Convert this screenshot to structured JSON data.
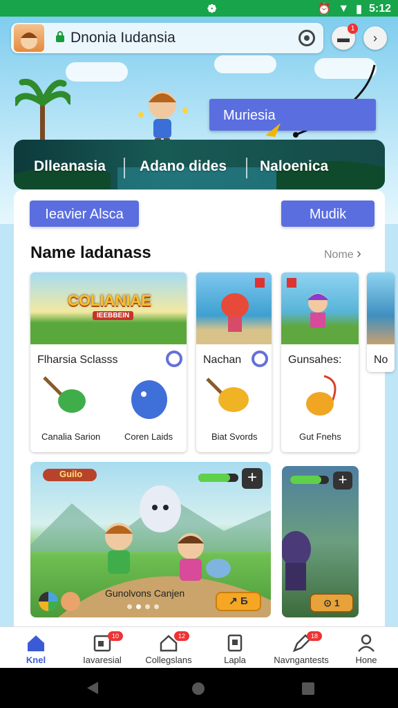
{
  "status_bar": {
    "time": "5:12",
    "icons": [
      "alarm-icon",
      "wifi-icon",
      "battery-icon"
    ]
  },
  "top_bar": {
    "title": "Dnonia Iudansia",
    "notification_count": "1"
  },
  "tooltip": {
    "label": "Muriesia"
  },
  "banner_tabs": [
    "Dlleanasia",
    "Adano dides",
    "Naloenica"
  ],
  "chips": {
    "left": "Ieavier Alsca",
    "right": "Mudik"
  },
  "section": {
    "title": "Name ladanass",
    "more": "Nome"
  },
  "game_cards": [
    {
      "logo": "COLIANIAE",
      "logo_sub": "IEEBBEIN",
      "title": "Flharsia Sclasss",
      "captions": [
        "Canalia Sarion",
        "Coren Laids"
      ]
    },
    {
      "title": "Nachan",
      "captions": [
        "Biat Svords"
      ]
    },
    {
      "title": "Gunsahes:",
      "captions": [
        "Gut Fnehs"
      ]
    },
    {
      "title": "No",
      "captions": []
    }
  ],
  "feature_tiles": [
    {
      "badge": "Guilo",
      "caption": "Gunolvons Canjen",
      "action": "↗ Б",
      "plus": "+"
    },
    {
      "action": "⊙ 1",
      "plus": "+"
    }
  ],
  "bottom_nav": [
    {
      "label": "Knel",
      "icon": "home-icon",
      "badge": ""
    },
    {
      "label": "Iavaresial",
      "icon": "calendar-icon",
      "badge": "10"
    },
    {
      "label": "Collegslans",
      "icon": "house-icon",
      "badge": "12"
    },
    {
      "label": "Lapla",
      "icon": "clipboard-icon",
      "badge": ""
    },
    {
      "label": "Navngantests",
      "icon": "pen-icon",
      "badge": "18"
    },
    {
      "label": "Hone",
      "icon": "person-icon",
      "badge": ""
    }
  ],
  "colors": {
    "accent": "#5a6ee0",
    "status_bar": "#17a44a",
    "active_nav": "#3b5bd6"
  }
}
